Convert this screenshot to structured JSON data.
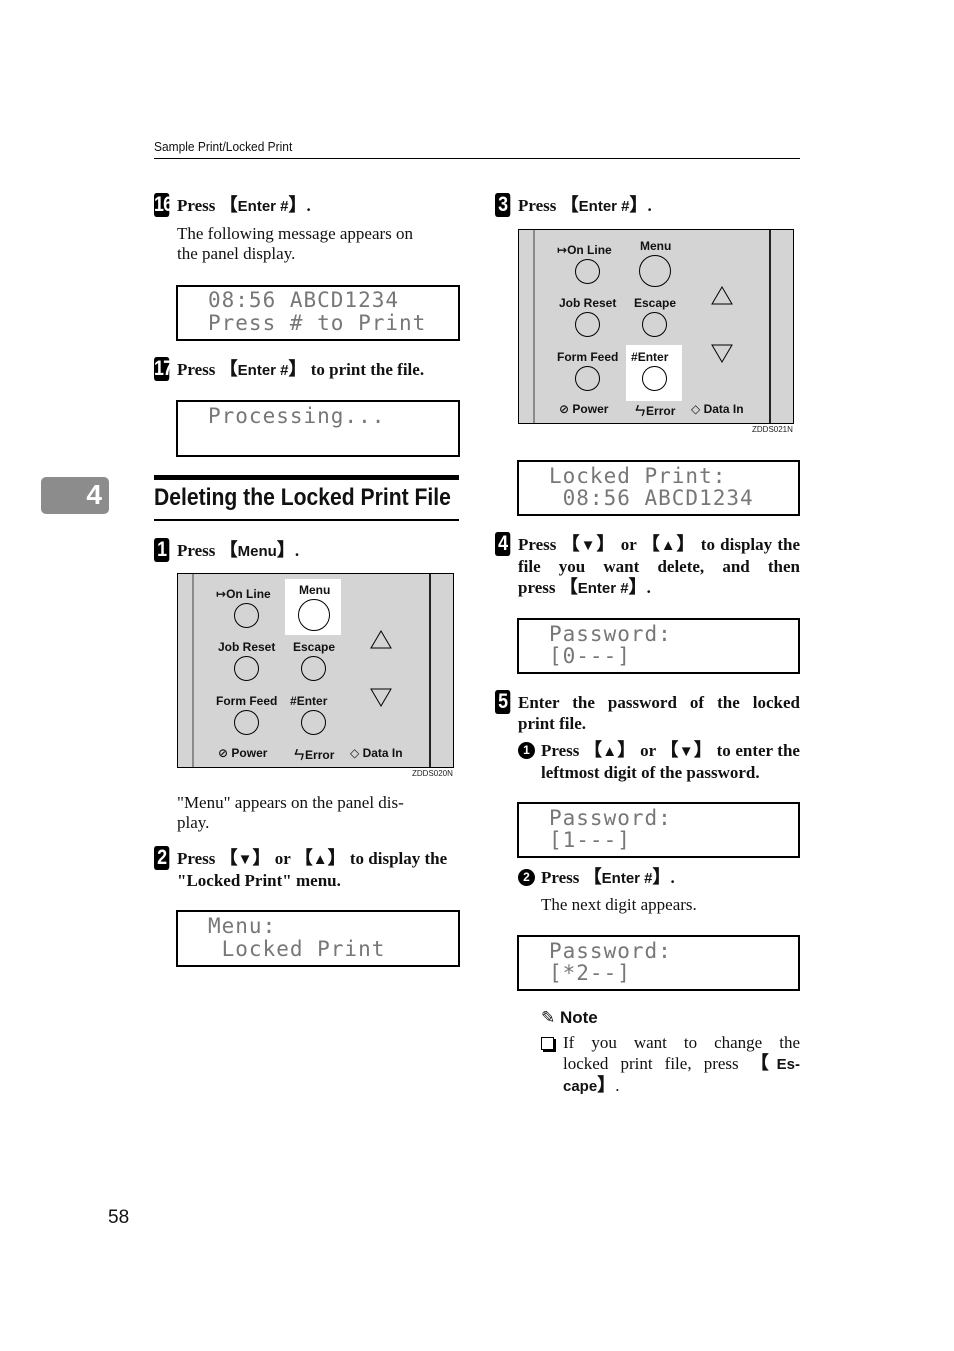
{
  "header": {
    "title": "Sample Print/Locked Print"
  },
  "chapter_tab": "4",
  "page_number": "58",
  "left_column": {
    "step16": {
      "num": "16",
      "prefix": "Press ",
      "key": "Enter #",
      "suffix": ".",
      "desc_line1": "The following message appears on",
      "desc_line2": "the panel display."
    },
    "lcd16": {
      "line1": "08:56 ABCD1234",
      "line2": "Press # to Print"
    },
    "step17": {
      "num": "17",
      "prefix": "Press ",
      "key": "Enter #",
      "suffix": " to print the file."
    },
    "lcd17": {
      "line1": "Processing...",
      "line2": ""
    },
    "section_title": "Deleting the Locked Print File",
    "step1": {
      "num": "1",
      "prefix": "Press ",
      "key": "Menu",
      "suffix": "."
    },
    "panel1": {
      "code": "ZDDS020N",
      "highlighted": "Menu"
    },
    "step1_desc_line1": "\"Menu\" appears on the panel dis-",
    "step1_desc_line2": "play.",
    "step2": {
      "num": "2",
      "line1_prefix": "Press ",
      "key_down": "▼",
      "or": " or ",
      "key_up": "▲",
      "line1_suffix": " to display the",
      "line2": "\"Locked Print\" menu."
    },
    "lcd2": {
      "line1": "Menu:",
      "line2": " Locked Print"
    }
  },
  "right_column": {
    "step3": {
      "num": "3",
      "prefix": "Press ",
      "key": "Enter #",
      "suffix": "."
    },
    "panel3": {
      "code": "ZDDS021N",
      "highlighted": "Enter"
    },
    "lcd3": {
      "line1": "Locked Print:",
      "line2": " 08:56 ABCD1234"
    },
    "step4": {
      "num": "4",
      "line1": "Press ",
      "key_down": "▼",
      "or": " or ",
      "key_up": "▲",
      "line1_suffix": " to display the",
      "line2": "file you want delete, and then",
      "line3_prefix": "press ",
      "key_enter": "Enter #",
      "line3_suffix": "."
    },
    "lcd4": {
      "line1": "Password:",
      "line2": "[0---]"
    },
    "step5": {
      "num": "5",
      "line1": "Enter the password of the locked",
      "line2": "print file."
    },
    "sub1": {
      "num": "1",
      "prefix": "Press ",
      "key_up": "▲",
      "or": " or ",
      "key_down": "▼",
      "suffix": " to enter the",
      "line2": "leftmost digit of the password."
    },
    "lcd5a": {
      "line1": "Password:",
      "line2": "[1---]"
    },
    "sub2": {
      "num": "2",
      "prefix": "Press ",
      "key": "Enter #",
      "suffix": ".",
      "desc": "The next digit appears."
    },
    "lcd5b": {
      "line1": "Password:",
      "line2": "[*2--]"
    },
    "note": {
      "title": "Note",
      "line1": "If you want to change the",
      "line2_prefix": "locked print file, press ",
      "key_part1": "Es-",
      "key_part2": "cape",
      "suffix": "."
    }
  },
  "panel_labels": {
    "on_line": "On Line",
    "menu": "Menu",
    "job_reset": "Job Reset",
    "escape": "Escape",
    "form_feed": "Form Feed",
    "enter": "Enter",
    "power": "Power",
    "error": "Error",
    "data_in": "Data In"
  }
}
